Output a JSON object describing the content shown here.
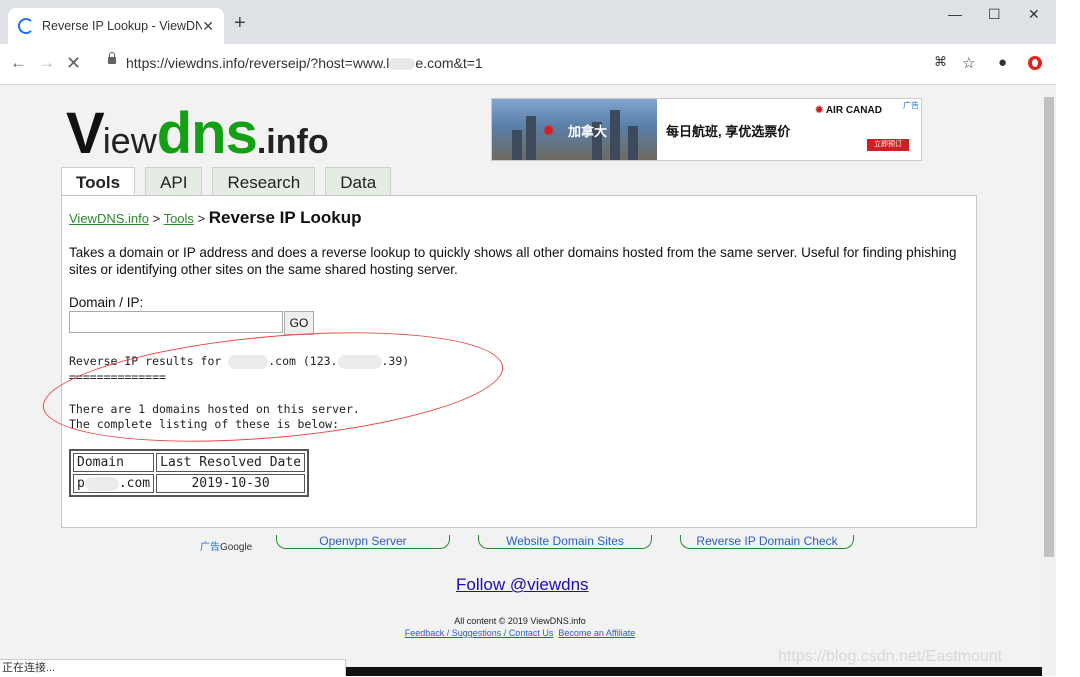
{
  "browser": {
    "tab_title": "Reverse IP Lookup - ViewDNS.",
    "url_prefix": "https://viewdns.info/reverseip/?host=www.l",
    "url_suffix": "e.com&t=1"
  },
  "logo": {
    "v": "V",
    "iew": "iew",
    "dns": "dns",
    "info": ".info"
  },
  "ad": {
    "city_text": "加拿大",
    "slogan": "每日航班, 享优选票价",
    "brand": "AIR CANAD",
    "ad_tag": "广告",
    "cta": "立即预订"
  },
  "tabs": [
    "Tools",
    "API",
    "Research",
    "Data"
  ],
  "breadcrumb": {
    "home": "ViewDNS.info",
    "tools": "Tools",
    "current": "Reverse IP Lookup"
  },
  "description": "Takes a domain or IP address and does a reverse lookup to quickly shows all other domains hosted from the same server. Useful for finding phishing sites or identifying other sites on the same shared hosting server.",
  "form": {
    "label": "Domain / IP:",
    "value": "",
    "go": "GO"
  },
  "results": {
    "line1_prefix": "Reverse IP results for ",
    "line1_mid": ".com (123.",
    "line1_suffix": ".39)",
    "separator": "==============",
    "count_line": "There are 1 domains hosted on this server.",
    "listing_line": "The complete listing of these is below:"
  },
  "table": {
    "headers": [
      "Domain",
      "Last Resolved Date"
    ],
    "rows": [
      {
        "domain_prefix": "p",
        "domain_suffix": ".com",
        "date": "2019-10-30"
      }
    ]
  },
  "adlinks": {
    "google_tag": "广告",
    "google": "Google",
    "links": [
      "Openvpn Server",
      "Website Domain Sites",
      "Reverse IP Domain Check"
    ]
  },
  "follow": "Follow @viewdns",
  "footer": {
    "copyright": "All content © 2019 ViewDNS.info",
    "feedback": "Feedback / Suggestions / Contact Us",
    "affiliate": "Become an Affiliate"
  },
  "status": "正在连接...",
  "watermark": "https://blog.csdn.net/Eastmount"
}
